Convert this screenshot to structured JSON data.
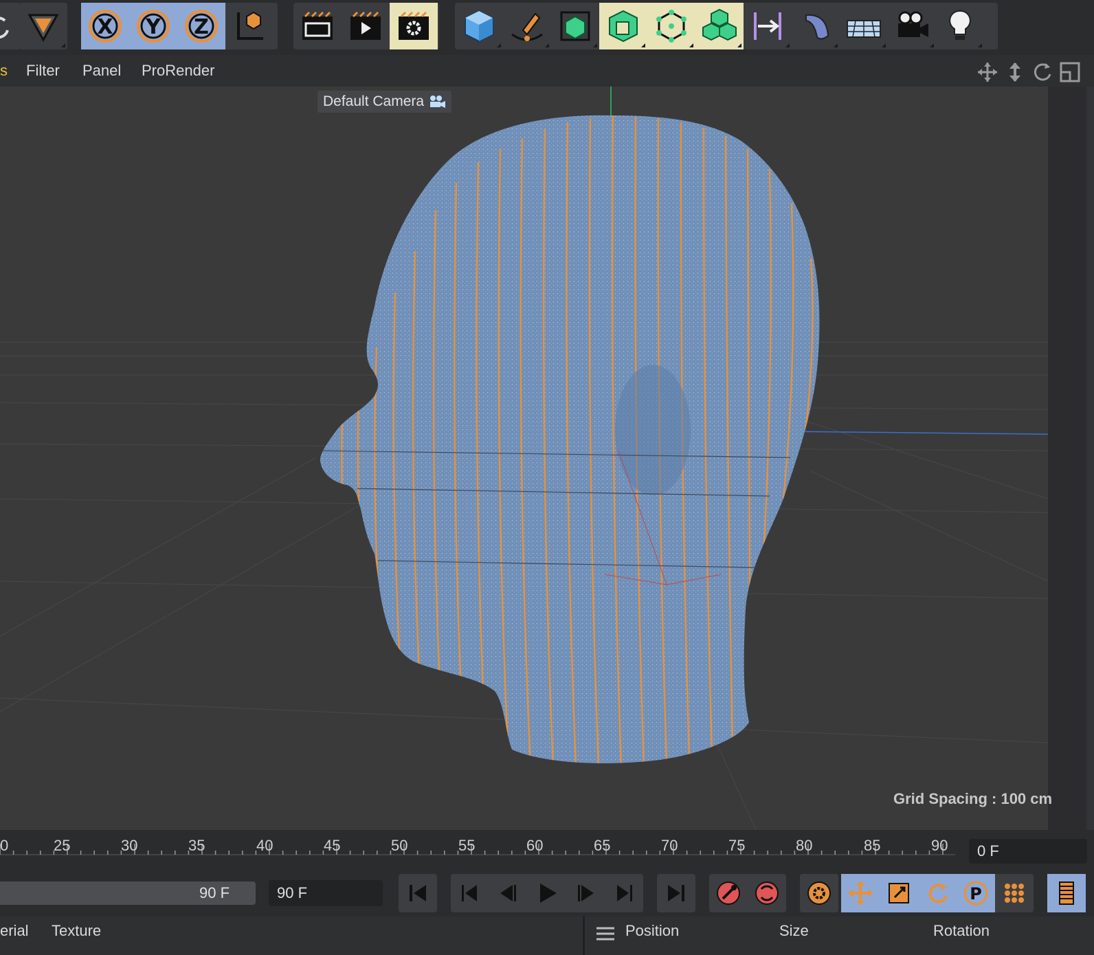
{
  "toolbar": {
    "groups": [
      {
        "buttons": [
          {
            "icon": "rotate-icon"
          }
        ]
      },
      {
        "buttons": [
          {
            "icon": "model-mode-icon"
          }
        ]
      },
      {
        "buttons": [
          {
            "icon": "axis-x-lock-icon",
            "label": "X"
          },
          {
            "icon": "axis-y-lock-icon",
            "label": "Y"
          },
          {
            "icon": "axis-z-lock-icon",
            "label": "Z"
          },
          {
            "icon": "coordinate-system-icon"
          }
        ]
      },
      {
        "buttons": [
          {
            "icon": "render-view-icon"
          },
          {
            "icon": "render-to-picture-viewer-icon"
          },
          {
            "icon": "render-settings-icon"
          }
        ]
      },
      {
        "buttons": [
          {
            "icon": "cube-icon"
          },
          {
            "icon": "pen-spline-icon"
          },
          {
            "icon": "subdivision-cube-icon"
          },
          {
            "icon": "extrude-cube-icon"
          },
          {
            "icon": "mograph-cloner-icon"
          },
          {
            "icon": "volume-cubes-icon"
          },
          {
            "icon": "deformer-bend-icon"
          },
          {
            "icon": "field-icon"
          },
          {
            "icon": "floor-icon"
          },
          {
            "icon": "camera-icon"
          },
          {
            "icon": "light-bulb-icon"
          }
        ]
      }
    ]
  },
  "menu": {
    "items": [
      "Filter",
      "Panel",
      "ProRender"
    ],
    "cut_item": "s"
  },
  "viewport": {
    "camera_label": "Default Camera",
    "grid_spacing": "Grid Spacing : 100 cm",
    "nav_icons": [
      "move-view-icon",
      "zoom-view-icon",
      "rotate-view-icon",
      "toggle-layout-icon"
    ]
  },
  "timeline": {
    "ticks": [
      "0",
      "25",
      "30",
      "35",
      "40",
      "45",
      "50",
      "55",
      "60",
      "65",
      "70",
      "75",
      "80",
      "85",
      "90"
    ],
    "current_frame": "0 F"
  },
  "transport": {
    "range_end": "90 F",
    "range_end_field": "90 F",
    "buttons": [
      "go-to-start-icon",
      "prev-key-icon",
      "prev-frame-icon",
      "play-icon",
      "next-frame-icon",
      "next-key-icon",
      "go-to-end-icon",
      "record-icon",
      "autokey-icon",
      "keyframe-settings-icon",
      "move-key-icon",
      "scale-key-icon",
      "rotate-key-icon",
      "param-key-icon",
      "point-level-icon",
      "timeline-icon"
    ]
  },
  "bottom": {
    "left_tabs": [
      "erial",
      "Texture"
    ],
    "right_headers": [
      "Position",
      "Size",
      "Rotation"
    ]
  },
  "colors": {
    "accent": "#8fa9d6",
    "orange": "#e8913a",
    "head": "#6f8fb8"
  }
}
